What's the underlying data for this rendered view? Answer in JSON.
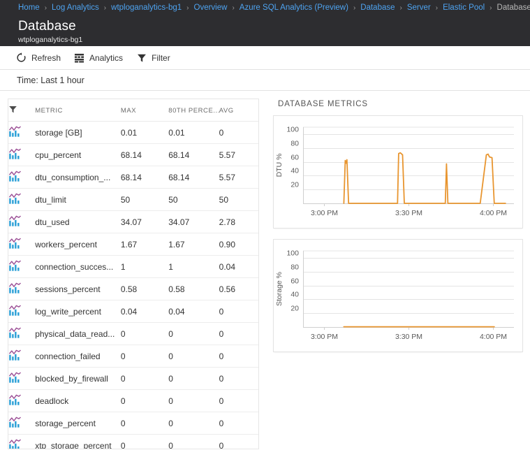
{
  "breadcrumb": {
    "separator": "›",
    "items": [
      {
        "label": "Home",
        "current": false
      },
      {
        "label": "Log Analytics",
        "current": false
      },
      {
        "label": "wtploganalytics-bg1",
        "current": false
      },
      {
        "label": "Overview",
        "current": false
      },
      {
        "label": "Azure SQL Analytics (Preview)",
        "current": false
      },
      {
        "label": "Database",
        "current": false
      },
      {
        "label": "Server",
        "current": false
      },
      {
        "label": "Elastic Pool",
        "current": false
      },
      {
        "label": "Database",
        "current": true
      }
    ]
  },
  "header": {
    "title": "Database",
    "subtitle": "wtploganalytics-bg1"
  },
  "toolbar": {
    "buttons": [
      {
        "label": "Refresh",
        "icon": "refresh-icon"
      },
      {
        "label": "Analytics",
        "icon": "analytics-icon"
      },
      {
        "label": "Filter",
        "icon": "filter-icon"
      }
    ]
  },
  "time_bar": {
    "text": "Time: Last 1 hour"
  },
  "metrics_table": {
    "filter_icon": "filter-icon",
    "columns": [
      "METRIC",
      "MAX",
      "80TH PERCE...",
      "AVG"
    ],
    "rows": [
      {
        "icon": "chart-icon",
        "metric": "storage [GB]",
        "max": "0.01",
        "p80": "0.01",
        "avg": "0"
      },
      {
        "icon": "chart-icon",
        "metric": "cpu_percent",
        "max": "68.14",
        "p80": "68.14",
        "avg": "5.57"
      },
      {
        "icon": "chart-icon",
        "metric": "dtu_consumption_...",
        "max": "68.14",
        "p80": "68.14",
        "avg": "5.57"
      },
      {
        "icon": "chart-icon",
        "metric": "dtu_limit",
        "max": "50",
        "p80": "50",
        "avg": "50"
      },
      {
        "icon": "chart-icon",
        "metric": "dtu_used",
        "max": "34.07",
        "p80": "34.07",
        "avg": "2.78"
      },
      {
        "icon": "chart-icon",
        "metric": "workers_percent",
        "max": "1.67",
        "p80": "1.67",
        "avg": "0.90"
      },
      {
        "icon": "chart-icon",
        "metric": "connection_succes...",
        "max": "1",
        "p80": "1",
        "avg": "0.04"
      },
      {
        "icon": "chart-icon",
        "metric": "sessions_percent",
        "max": "0.58",
        "p80": "0.58",
        "avg": "0.56"
      },
      {
        "icon": "chart-icon",
        "metric": "log_write_percent",
        "max": "0.04",
        "p80": "0.04",
        "avg": "0"
      },
      {
        "icon": "chart-icon",
        "metric": "physical_data_read...",
        "max": "0",
        "p80": "0",
        "avg": "0"
      },
      {
        "icon": "chart-icon",
        "metric": "connection_failed",
        "max": "0",
        "p80": "0",
        "avg": "0"
      },
      {
        "icon": "chart-icon",
        "metric": "blocked_by_firewall",
        "max": "0",
        "p80": "0",
        "avg": "0"
      },
      {
        "icon": "chart-icon",
        "metric": "deadlock",
        "max": "0",
        "p80": "0",
        "avg": "0"
      },
      {
        "icon": "chart-icon",
        "metric": "storage_percent",
        "max": "0",
        "p80": "0",
        "avg": "0"
      },
      {
        "icon": "chart-icon",
        "metric": "xtp_storage_percent",
        "max": "0",
        "p80": "0",
        "avg": "0"
      }
    ]
  },
  "charts_panel": {
    "heading": "DATABASE METRICS"
  },
  "colors": {
    "series": "#e8952f",
    "grid": "#e4e4e4",
    "axis_text": "#5a5a5a",
    "chrome_dark": "#2d2d30",
    "link_blue": "#4ea3f0",
    "icon_purple": "#9b4f96",
    "icon_blue": "#2a9fd6"
  },
  "chart_data": [
    {
      "type": "line",
      "title": "DTU %",
      "ylabel": "DTU %",
      "xlabel": "",
      "ylim": [
        0,
        110
      ],
      "yticks": [
        20,
        40,
        60,
        80,
        100
      ],
      "xticks": [
        "3:00 PM",
        "3:30 PM",
        "4:00 PM"
      ],
      "xlim_minutes": [
        0,
        75
      ],
      "grid": true,
      "legend": "none",
      "series": [
        {
          "name": "DTU %",
          "color": "#e8952f",
          "x": [
            14.5,
            15.0,
            15.3,
            15.6,
            16.2,
            16.6,
            30.0,
            33.6,
            34.0,
            34.6,
            35.4,
            36.0,
            36.6,
            48.0,
            50.6,
            51.0,
            51.5,
            52.2,
            63.0,
            65.2,
            65.8,
            66.3,
            67.2,
            68.0,
            72.0
          ],
          "y": [
            0,
            62,
            58,
            63,
            0,
            0,
            0,
            0,
            72,
            73,
            70,
            0,
            0,
            0,
            0,
            57,
            0,
            0,
            0,
            70,
            71,
            67,
            66,
            0,
            0
          ]
        }
      ]
    },
    {
      "type": "line",
      "title": "Storage %",
      "ylabel": "Storage %",
      "xlabel": "",
      "ylim": [
        0,
        110
      ],
      "yticks": [
        20,
        40,
        60,
        80,
        100
      ],
      "xticks": [
        "3:00 PM",
        "3:30 PM",
        "4:00 PM"
      ],
      "xlim_minutes": [
        0,
        75
      ],
      "grid": true,
      "legend": "none",
      "series": [
        {
          "name": "Storage %",
          "color": "#e8952f",
          "x": [
            14.5,
            68.0
          ],
          "y": [
            0.4,
            0.4
          ]
        }
      ]
    }
  ]
}
